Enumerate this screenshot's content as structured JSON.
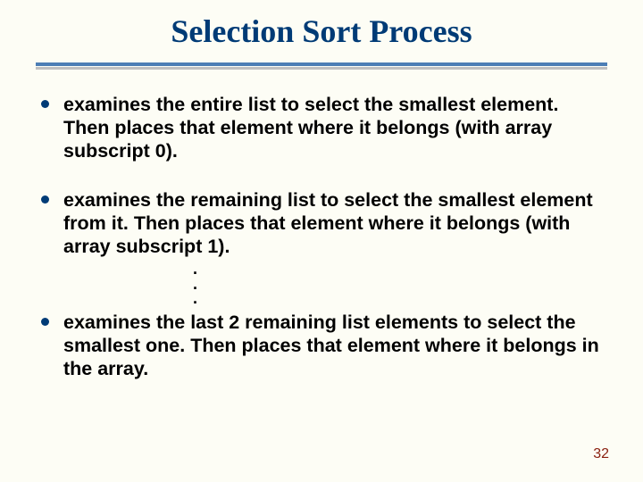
{
  "title": "Selection Sort Process",
  "bullets": {
    "b0": "examines the entire list to select the smallest element. Then places that element where it belongs (with array subscript 0).",
    "b1": "examines the remaining list to select the smallest element from it. Then places that element where it belongs (with array subscript 1).",
    "b2": "examines the last 2 remaining list elements to select the smallest one.  Then places that element where it belongs in the array."
  },
  "ellipsis": ".\n.\n.",
  "page_number": "32"
}
